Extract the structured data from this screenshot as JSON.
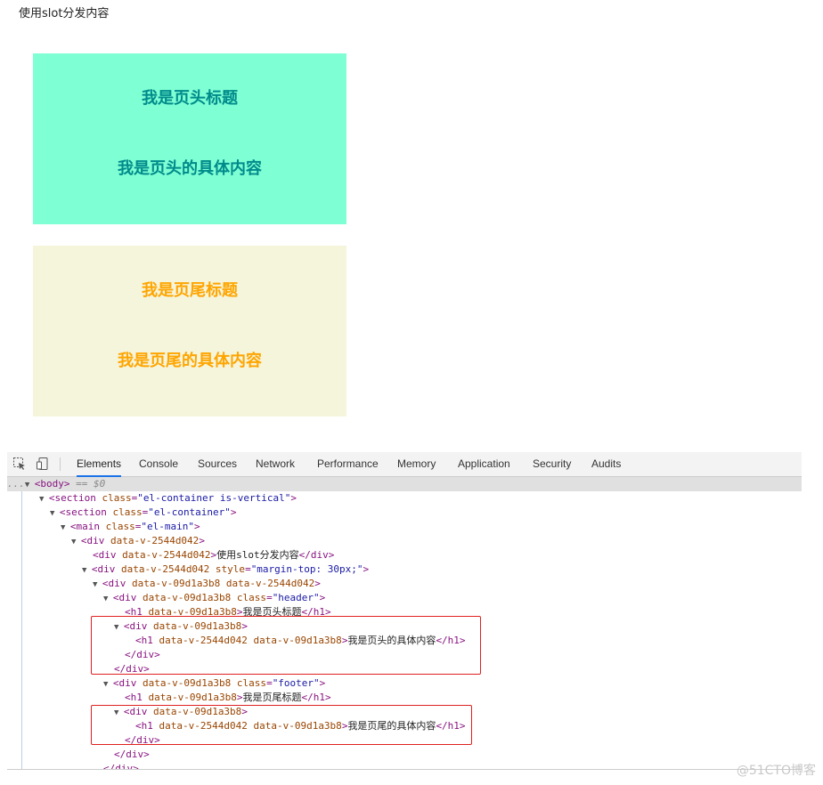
{
  "page": {
    "intro_text": "使用slot分发内容",
    "header_box": {
      "title": "我是页头标题",
      "content": "我是页头的具体内容",
      "background": "#7fffd4",
      "text_color": "#008b8b"
    },
    "footer_box": {
      "title": "我是页尾标题",
      "content": "我是页尾的具体内容",
      "background": "#f5f5dc",
      "text_color": "#ffa500"
    }
  },
  "devtools": {
    "tabs": [
      {
        "label": "Elements",
        "active": true
      },
      {
        "label": "Console"
      },
      {
        "label": "Sources"
      },
      {
        "label": "Network"
      },
      {
        "label": "Performance"
      },
      {
        "label": "Memory"
      },
      {
        "label": "Application"
      },
      {
        "label": "Security"
      },
      {
        "label": "Audits"
      }
    ],
    "dom_lines": [
      {
        "ellipsis": "...",
        "tri": "▼",
        "tag_open": "<body>",
        "note": " == $0"
      },
      {
        "tri": "▼",
        "tag": "section",
        "attrs": [
          {
            "n": "class",
            "v": "el-container is-vertical"
          }
        ]
      },
      {
        "tri": "▼",
        "tag": "section",
        "attrs": [
          {
            "n": "class",
            "v": "el-container"
          }
        ]
      },
      {
        "tri": "▼",
        "tag": "main",
        "attrs": [
          {
            "n": "class",
            "v": "el-main"
          }
        ]
      },
      {
        "tri": "▼",
        "tag": "div",
        "attrs": [
          {
            "n": "data-v-2544d042"
          }
        ]
      },
      {
        "tag": "div",
        "attrs": [
          {
            "n": "data-v-2544d042"
          }
        ],
        "text": "使用slot分发内容",
        "close": "</div>"
      },
      {
        "tri": "▼",
        "tag": "div",
        "attrs": [
          {
            "n": "data-v-2544d042"
          },
          {
            "n": "style",
            "v": "margin-top: 30px;"
          }
        ]
      },
      {
        "tri": "▼",
        "tag": "div",
        "attrs": [
          {
            "n": "data-v-09d1a3b8"
          },
          {
            "n": "data-v-2544d042"
          }
        ]
      },
      {
        "tri": "▼",
        "tag": "div",
        "attrs": [
          {
            "n": "data-v-09d1a3b8"
          },
          {
            "n": "class",
            "v": "header"
          }
        ]
      },
      {
        "tag": "h1",
        "attrs": [
          {
            "n": "data-v-09d1a3b8"
          }
        ],
        "text": "我是页头标题",
        "close": "</h1>"
      },
      {
        "tri": "▼",
        "tag": "div",
        "attrs": [
          {
            "n": "data-v-09d1a3b8"
          }
        ]
      },
      {
        "tag": "h1",
        "attrs": [
          {
            "n": "data-v-2544d042"
          },
          {
            "n": "data-v-09d1a3b8"
          }
        ],
        "text": "我是页头的具体内容",
        "close": "</h1>"
      },
      {
        "close": "</div>"
      },
      {
        "close": "</div>"
      },
      {
        "tri": "▼",
        "tag": "div",
        "attrs": [
          {
            "n": "data-v-09d1a3b8"
          },
          {
            "n": "class",
            "v": "footer"
          }
        ]
      },
      {
        "tag": "h1",
        "attrs": [
          {
            "n": "data-v-09d1a3b8"
          }
        ],
        "text": "我是页尾标题",
        "close": "</h1>"
      },
      {
        "tri": "▼",
        "tag": "div",
        "attrs": [
          {
            "n": "data-v-09d1a3b8"
          }
        ]
      },
      {
        "tag": "h1",
        "attrs": [
          {
            "n": "data-v-2544d042"
          },
          {
            "n": "data-v-09d1a3b8"
          }
        ],
        "text": "我是页尾的具体内容",
        "close": "</h1>"
      },
      {
        "close": "</div>"
      },
      {
        "close": "</div>"
      },
      {
        "close": "</div>"
      }
    ]
  },
  "watermark": "@51CTO博客"
}
